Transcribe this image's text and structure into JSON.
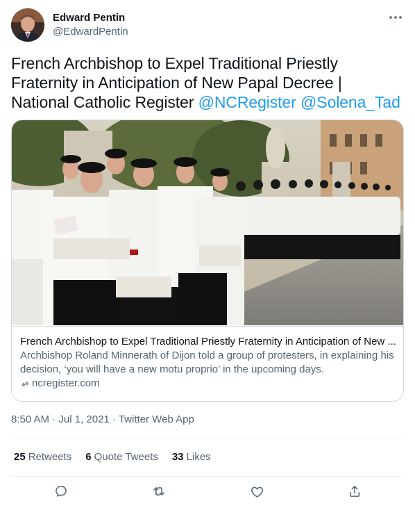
{
  "author": {
    "name": "Edward Pentin",
    "handle": "@EdwardPentin",
    "avatar_icon": "profile-avatar"
  },
  "tweet": {
    "text_main": "French Archbishop to Expel Traditional Priestly Fraternity in Anticipation of New Papal Decree | National Catholic Register",
    "mention_1": "@NCRegister",
    "mention_2": "@Solena_Tad"
  },
  "card": {
    "title": "French Archbishop to Expel Traditional Priestly Fraternity in Anticipation of New ...",
    "description": "Archbishop Roland Minnerath of Dijon told a group of protesters, in explaining his decision, ‘you will have a new motu proprio’ in the upcoming days.",
    "domain": "ncregister.com",
    "image_icon": "photo-procession-of-seminarians"
  },
  "meta": {
    "time": "8:50 AM",
    "separator": " · ",
    "date": "Jul 1, 2021",
    "source": "Twitter Web App"
  },
  "stats": {
    "retweets_count": "25",
    "retweets_label": "Retweets",
    "quotes_count": "6",
    "quotes_label": "Quote Tweets",
    "likes_count": "33",
    "likes_label": "Likes"
  },
  "actions": [
    "reply-icon",
    "retweet-icon",
    "like-icon",
    "share-icon"
  ],
  "colors": {
    "link": "#1d9bf0",
    "secondary_text": "#536471",
    "primary_text": "#0f1419",
    "border": "#cfd9de"
  }
}
